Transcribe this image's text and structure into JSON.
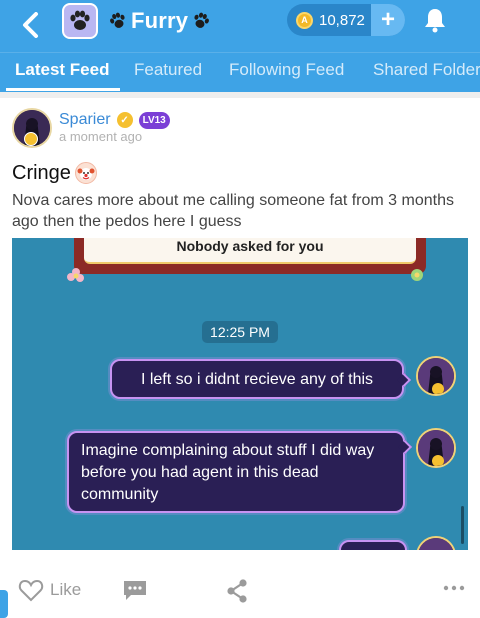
{
  "header": {
    "title": "Furry",
    "coin_count": "10,872",
    "colors": {
      "bar": "#3ea3e6",
      "coin_pill": "#2a86c9"
    }
  },
  "tabs": [
    {
      "label": "Latest Feed",
      "active": true
    },
    {
      "label": "Featured",
      "active": false
    },
    {
      "label": "Following Feed",
      "active": false
    },
    {
      "label": "Shared Folder",
      "active": false
    }
  ],
  "post": {
    "author": "Sparier",
    "level": "LV13",
    "timestamp": "a moment ago",
    "title": "Cringe",
    "body": "Nova cares more about me calling someone fat from 3 months ago then the pedos here I guess"
  },
  "screenshot": {
    "card_text": "Nobody asked for you",
    "time": "12:25 PM",
    "messages": [
      "I left so i didnt recieve any of this",
      "Imagine complaining about stuff I did way before you had agent in this dead community"
    ]
  },
  "footer": {
    "like_label": "Like"
  },
  "icons": [
    "back-icon",
    "paw-icon",
    "coin-icon",
    "plus-icon",
    "bell-icon",
    "curator-icon",
    "clown-icon",
    "heart-icon",
    "comment-icon",
    "share-icon",
    "more-icon"
  ]
}
